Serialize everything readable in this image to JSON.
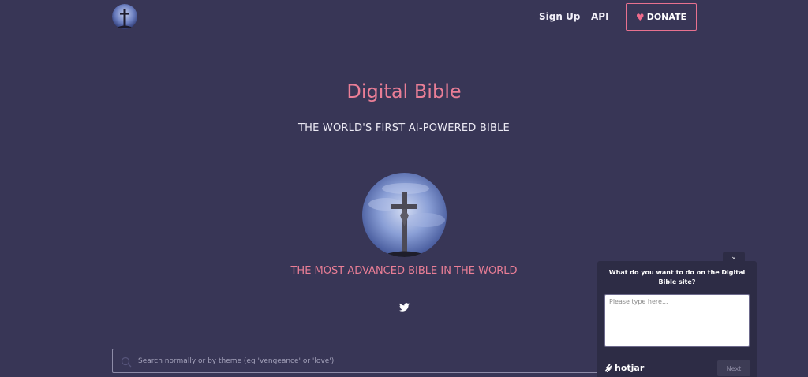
{
  "nav": {
    "sign_up": "Sign Up",
    "api": "API",
    "donate": "DONATE"
  },
  "hero": {
    "title": "Digital Bible",
    "tagline": "THE WORLD'S FIRST AI-POWERED BIBLE",
    "subtagline": "THE MOST ADVANCED BIBLE IN THE WORLD"
  },
  "search": {
    "placeholder": "Search normally or by theme (eg 'vengeance' or 'love')",
    "value": ""
  },
  "hotjar": {
    "question": "What do you want to do on the Digital Bible site?",
    "placeholder": "Please type here...",
    "brand": "hotjar",
    "next_label": "Next"
  },
  "colors": {
    "background": "#383656",
    "accent_pink": "#ea7e96",
    "widget_bg": "#2d2c45"
  },
  "icons": [
    "cross-logo-icon",
    "heart-icon",
    "twitter-icon",
    "search-icon",
    "chevron-down-icon",
    "hotjar-logo-icon"
  ]
}
